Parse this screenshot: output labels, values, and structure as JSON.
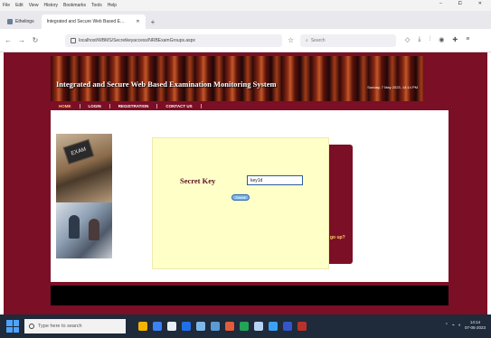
{
  "browser": {
    "menu": [
      "File",
      "Edit",
      "View",
      "History",
      "Bookmarks",
      "Tools",
      "Help"
    ],
    "window_controls": [
      "–",
      "⧠",
      "✕"
    ],
    "tabs": [
      {
        "label": "Ethelings"
      },
      {
        "label": "Integrated and Secure Web Based E…"
      }
    ],
    "new_tab": "+",
    "url": "localhost/WBMS/Secretkeyaccess/NRBExamGroups.aspx",
    "search_placeholder": "Search"
  },
  "site": {
    "title": "Integrated and Secure Web Based Examination Monitoring System",
    "date": "Sunday, 7 May 2023, 14:14 PM",
    "nav": [
      "HOME",
      "LOGIN",
      "REGISTRATION",
      "CONTACT US"
    ],
    "board_text": "EXAM",
    "side_text": "go up?"
  },
  "form": {
    "secret_key_label": "Secret Key",
    "secret_key_value": "key1d",
    "submit_label": "Submit"
  },
  "taskbar": {
    "search_placeholder": "Type here to search",
    "time": "14:14",
    "date": "07-05-2023",
    "app_colors": [
      "#f4b400",
      "#3b82f6",
      "#e8eef5",
      "#1f6feb",
      "#7fb6e8",
      "#5b9bd5",
      "#e25c3b",
      "#22a35a",
      "#b5d3f3",
      "#3ba1f5",
      "#3456c8",
      "#b8322a"
    ]
  },
  "colors": {
    "maroon": "#7b0f26",
    "panel": "#ffffc8",
    "nav_active": "#ffcf6a"
  }
}
